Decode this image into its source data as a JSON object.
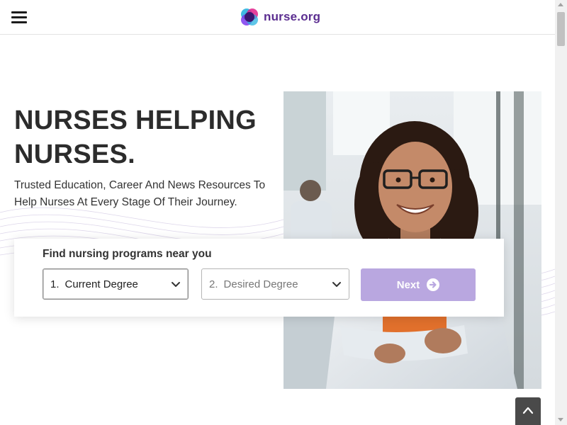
{
  "header": {
    "menu_icon": "hamburger-menu-icon",
    "logo_text": "nurse.org",
    "logo_colors": [
      "#5b2d90",
      "#e0208a",
      "#2bb3e0",
      "#7c3aed"
    ]
  },
  "hero": {
    "title": "NURSES HELPING NURSES.",
    "subtitle": "Trusted Education, Career And News Resources To Help Nurses At Every Stage Of Their Journey."
  },
  "search": {
    "label": "Find nursing programs near you",
    "current_degree": {
      "number": "1.",
      "label": "Current Degree"
    },
    "desired_degree": {
      "number": "2.",
      "label": "Desired Degree"
    },
    "next_label": "Next",
    "next_icon": "arrow-right-circle-icon"
  },
  "colors": {
    "brand_purple": "#5b2d90",
    "button_lavender": "#b9a7e0",
    "title_text": "#2c2c2c"
  },
  "back_to_top_icon": "chevron-up-icon"
}
